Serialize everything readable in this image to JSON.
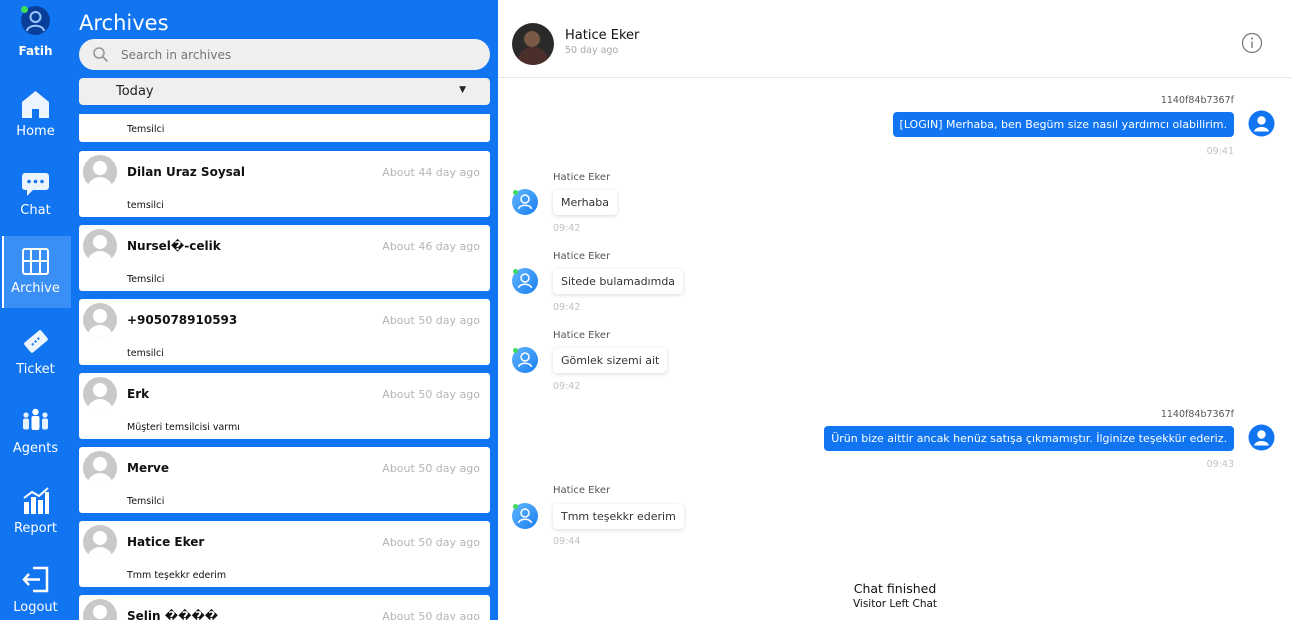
{
  "user": {
    "name": "Fatih"
  },
  "nav": [
    {
      "label": "Home",
      "icon": "home-icon"
    },
    {
      "label": "Chat",
      "icon": "chat-icon"
    },
    {
      "label": "Archive",
      "icon": "archive-icon"
    },
    {
      "label": "Ticket",
      "icon": "ticket-icon"
    },
    {
      "label": "Agents",
      "icon": "agents-icon"
    },
    {
      "label": "Report",
      "icon": "report-icon"
    },
    {
      "label": "Logout",
      "icon": "logout-icon"
    }
  ],
  "archives": {
    "title": "Archives",
    "search_placeholder": "Search in archives",
    "filter_value": "Today",
    "partial_top_message": "Temsilci",
    "items": [
      {
        "name": "Dilan Uraz Soysal",
        "time": "About 44 day ago",
        "message": "temsilci"
      },
      {
        "name": "Nursel�-celik",
        "time": "About 46 day ago",
        "message": "Temsilci"
      },
      {
        "name": "+905078910593",
        "time": "About 50 day ago",
        "message": "temsilci"
      },
      {
        "name": "Erk",
        "time": "About 50 day ago",
        "message": "Müşteri temsilcisi varmı"
      },
      {
        "name": "Merve",
        "time": "About 50 day ago",
        "message": "Temsilci"
      },
      {
        "name": "Hatice Eker",
        "time": "About 50 day ago",
        "message": "Tmm teşekkr ederim"
      },
      {
        "name": "Selin ����",
        "time": "About 50 day ago",
        "message": ""
      }
    ]
  },
  "chat": {
    "contact_name": "Hatice Eker",
    "contact_sub": "50 day ago",
    "messages": [
      {
        "side": "out",
        "sender": "1140f84b7367f",
        "text": "[LOGIN] Merhaba, ben Begüm size nasıl yardımcı olabilirim.",
        "time": "09:41"
      },
      {
        "side": "in",
        "sender": "Hatice Eker",
        "text": "Merhaba",
        "time": "09:42"
      },
      {
        "side": "in",
        "sender": "Hatice Eker",
        "text": "Sitede bulamadımda",
        "time": "09:42"
      },
      {
        "side": "in",
        "sender": "Hatice Eker",
        "text": "Gömlek sizemi ait",
        "time": "09:42"
      },
      {
        "side": "out",
        "sender": "1140f84b7367f",
        "text": "Ürün bize aittir ancak henüz satışa çıkmamıştır. İlginize teşekkür ederiz.",
        "time": "09:43"
      },
      {
        "side": "in",
        "sender": "Hatice Eker",
        "text": "Tmm teşekkr ederim",
        "time": "09:44"
      }
    ],
    "finished_title": "Chat finished",
    "finished_sub": "Visitor Left Chat"
  },
  "colors": {
    "primary": "#1175f2",
    "card": "#ffffff",
    "muted": "#b5b5b5",
    "online": "#3ddc5c"
  }
}
